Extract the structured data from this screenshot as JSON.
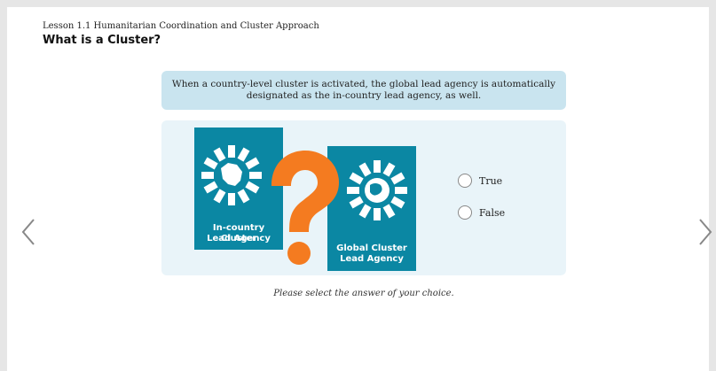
{
  "header": {
    "lesson_label": "Lesson 1.1  Humanitarian Coordination and Cluster Approach",
    "title": "What is a Cluster?"
  },
  "question": {
    "text": "When a country-level cluster is activated, the global lead agency is automatically designated as the in-country lead agency, as well."
  },
  "cards": [
    {
      "caption_line1": "In-country Cluster",
      "caption_line2": "Lead Agency",
      "icon": "country-map-wheel-icon"
    },
    {
      "caption_line1": "Global Cluster",
      "caption_line2": "Lead Agency",
      "icon": "globe-wheel-icon"
    }
  ],
  "decoration": {
    "icon": "question-mark-icon",
    "color": "#f47b20"
  },
  "answers": [
    {
      "label": "True"
    },
    {
      "label": "False"
    }
  ],
  "hint": "Please select the answer of your choice.",
  "nav": {
    "prev_icon": "chevron-left-icon",
    "next_icon": "chevron-right-icon"
  },
  "colors": {
    "accent": "#0b87a3",
    "question_bg": "#c9e4ef",
    "panel_bg": "#e9f4f9",
    "orange": "#f47b20"
  }
}
